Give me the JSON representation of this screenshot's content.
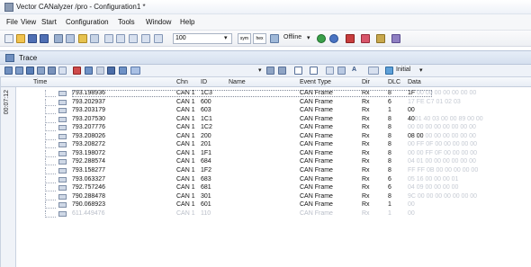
{
  "window": {
    "title": "Vector CANalyzer /pro - Configuration1 *"
  },
  "menu": [
    "File",
    "View",
    "Start",
    "Configuration",
    "Tools",
    "Window",
    "Help"
  ],
  "toolbar": {
    "zoom_value": "100",
    "unit_a": "sym",
    "unit_b": "hex",
    "offline_label": "Offline"
  },
  "trace_tab": {
    "label": "Trace"
  },
  "trace_toolbar": {
    "initial_label": "Initial"
  },
  "columns": [
    "Time",
    "Chn",
    "ID",
    "Name",
    "Event Type",
    "Dir",
    "DLC",
    "Data"
  ],
  "time_strip_label": "00:07:12",
  "rows": [
    {
      "time": "793.198936",
      "chn": "CAN 1",
      "id": "1C3",
      "name": "",
      "event": "CAN Frame",
      "dir": "Rx",
      "dlc": "8",
      "data_main": "1F",
      "data_rest": " 00 00 00 00 00 00 00"
    },
    {
      "time": "793.202937",
      "chn": "CAN 1",
      "id": "600",
      "name": "",
      "event": "CAN Frame",
      "dir": "Rx",
      "dlc": "6",
      "data_main": "",
      "data_rest": "17 FE C7 01 02 03"
    },
    {
      "time": "793.203179",
      "chn": "CAN 1",
      "id": "603",
      "name": "",
      "event": "CAN Frame",
      "dir": "Rx",
      "dlc": "1",
      "data_main": "00",
      "data_rest": ""
    },
    {
      "time": "793.207530",
      "chn": "CAN 1",
      "id": "1C1",
      "name": "",
      "event": "CAN Frame",
      "dir": "Rx",
      "dlc": "8",
      "data_main": "40",
      "data_rest": "01 40 03 00 00 89 00 00"
    },
    {
      "time": "793.207776",
      "chn": "CAN 1",
      "id": "1C2",
      "name": "",
      "event": "CAN Frame",
      "dir": "Rx",
      "dlc": "8",
      "data_main": "",
      "data_rest": "00 00 00 00 00 00 00 00"
    },
    {
      "time": "793.208026",
      "chn": "CAN 1",
      "id": "200",
      "name": "",
      "event": "CAN Frame",
      "dir": "Rx",
      "dlc": "8",
      "data_main": "08 00",
      "data_rest": " 00 00 00 00 00 00"
    },
    {
      "time": "793.208272",
      "chn": "CAN 1",
      "id": "201",
      "name": "",
      "event": "CAN Frame",
      "dir": "Rx",
      "dlc": "8",
      "data_main": "",
      "data_rest": "00 FF 0F 00 00 00 00 00"
    },
    {
      "time": "793.198072",
      "chn": "CAN 1",
      "id": "1F1",
      "name": "",
      "event": "CAN Frame",
      "dir": "Rx",
      "dlc": "8",
      "data_main": "",
      "data_rest": "00 00 FF 0F 00 00 00 00"
    },
    {
      "time": "792.288574",
      "chn": "CAN 1",
      "id": "684",
      "name": "",
      "event": "CAN Frame",
      "dir": "Rx",
      "dlc": "8",
      "data_main": "",
      "data_rest": "04 01 00 00 00 00 00 00"
    },
    {
      "time": "793.158277",
      "chn": "CAN 1",
      "id": "1F2",
      "name": "",
      "event": "CAN Frame",
      "dir": "Rx",
      "dlc": "8",
      "data_main": "",
      "data_rest": "FF FF 0B 00 00 00 00 00"
    },
    {
      "time": "793.063327",
      "chn": "CAN 1",
      "id": "683",
      "name": "",
      "event": "CAN Frame",
      "dir": "Rx",
      "dlc": "6",
      "data_main": "",
      "data_rest": "05 16 00 00 00 01"
    },
    {
      "time": "792.757246",
      "chn": "CAN 1",
      "id": "681",
      "name": "",
      "event": "CAN Frame",
      "dir": "Rx",
      "dlc": "6",
      "data_main": "",
      "data_rest": "04 09 00 00 00 00"
    },
    {
      "time": "790.288478",
      "chn": "CAN 1",
      "id": "301",
      "name": "",
      "event": "CAN Frame",
      "dir": "Rx",
      "dlc": "8",
      "data_main": "",
      "data_rest": "9C 00 00 00 00 00 00 00"
    },
    {
      "time": "790.068923",
      "chn": "CAN 1",
      "id": "601",
      "name": "",
      "event": "CAN Frame",
      "dir": "Rx",
      "dlc": "1",
      "data_main": "",
      "data_rest": "00"
    },
    {
      "time": "611.449476",
      "chn": "CAN 1",
      "id": "110",
      "name": "",
      "event": "CAN Frame",
      "dir": "Rx",
      "dlc": "1",
      "data_main": "",
      "data_rest": "00",
      "faded": true
    }
  ]
}
